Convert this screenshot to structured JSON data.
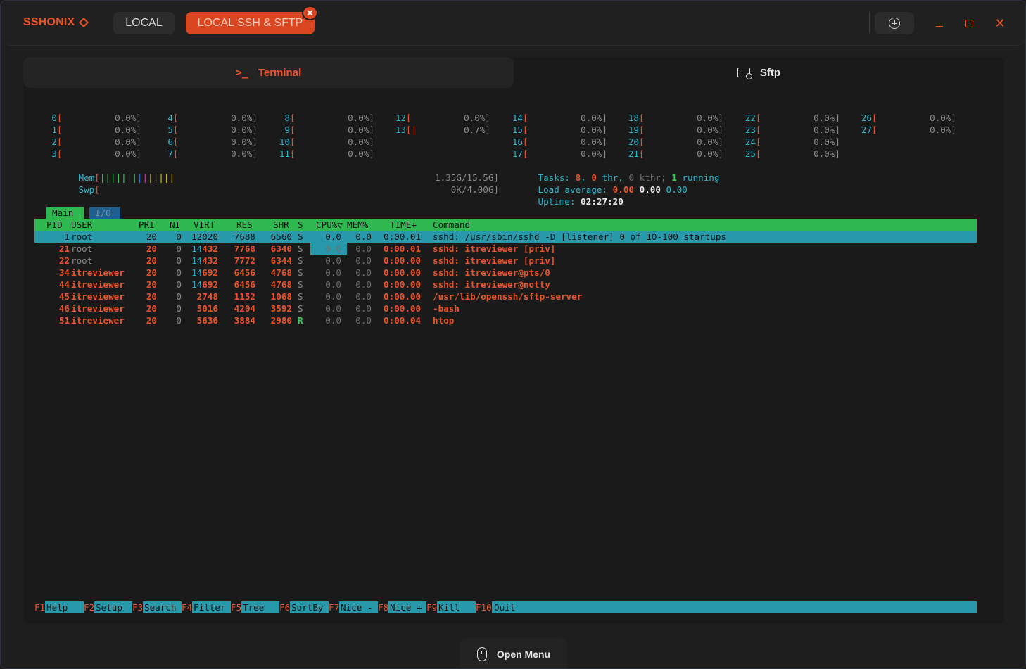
{
  "app": {
    "brand": "SSHONIX",
    "tabs": [
      {
        "label": "LOCAL",
        "active": false
      },
      {
        "label": "LOCAL SSH & SFTP",
        "active": true
      }
    ],
    "accent_color": "#e8542a"
  },
  "subtabs": {
    "terminal": "Terminal",
    "sftp": "Sftp"
  },
  "htop": {
    "cpus": [
      {
        "id": "0",
        "pct": "0.0%]"
      },
      {
        "id": "1",
        "pct": "0.0%]"
      },
      {
        "id": "2",
        "pct": "0.0%]"
      },
      {
        "id": "3",
        "pct": "0.0%]"
      },
      {
        "id": "4",
        "pct": "0.0%]"
      },
      {
        "id": "5",
        "pct": "0.0%]"
      },
      {
        "id": "6",
        "pct": "0.0%]"
      },
      {
        "id": "7",
        "pct": "0.0%]"
      },
      {
        "id": "8",
        "pct": "0.0%]"
      },
      {
        "id": "9",
        "pct": "0.0%]"
      },
      {
        "id": "10",
        "pct": "0.0%]"
      },
      {
        "id": "11",
        "pct": "0.0%]"
      },
      {
        "id": "12",
        "pct": "0.0%]"
      },
      {
        "id": "13",
        "pct": "0.7%]"
      },
      {
        "id": "14",
        "pct": "0.0%]"
      },
      {
        "id": "15",
        "pct": "0.0%]"
      },
      {
        "id": "16",
        "pct": "0.0%]"
      },
      {
        "id": "17",
        "pct": "0.0%]"
      },
      {
        "id": "18",
        "pct": "0.0%]"
      },
      {
        "id": "19",
        "pct": "0.0%]"
      },
      {
        "id": "20",
        "pct": "0.0%]"
      },
      {
        "id": "21",
        "pct": "0.0%]"
      },
      {
        "id": "22",
        "pct": "0.0%]"
      },
      {
        "id": "23",
        "pct": "0.0%]"
      },
      {
        "id": "24",
        "pct": "0.0%]"
      },
      {
        "id": "25",
        "pct": "0.0%]"
      },
      {
        "id": "26",
        "pct": "0.0%]"
      },
      {
        "id": "27",
        "pct": "0.0%]"
      }
    ],
    "mem_label": "Mem",
    "mem_value": "1.35G/15.5G]",
    "swp_label": "Swp",
    "swp_value": "0K/4.00G]",
    "tasks_label": "Tasks:",
    "tasks": "8",
    "thr": "0",
    "thr_label": "thr,",
    "kthr": "0",
    "kthr_label": "kthr;",
    "running": "1",
    "running_label": "running",
    "load_label": "Load average:",
    "load1": "0.00",
    "load5": "0.00",
    "load15": "0.00",
    "uptime_label": "Uptime:",
    "uptime": "02:27:20",
    "tab_main": "Main",
    "tab_io": "I/O",
    "columns": [
      "PID",
      "USER",
      "PRI",
      "NI",
      "VIRT",
      "RES",
      "SHR",
      "S",
      "CPU%▽",
      "MEM%",
      "TIME+",
      "Command"
    ],
    "processes": [
      {
        "pid": "1",
        "user": "root",
        "pri": "20",
        "ni": "0",
        "virt": "12020",
        "res": "7688",
        "shr": "6560",
        "s": "S",
        "cpu": "0.0",
        "mem": "0.0",
        "time": "0:00.01",
        "cmd": "sshd: /usr/sbin/sshd -D [listener] 0 of 10-100 startups"
      },
      {
        "pid": "21",
        "user": "root",
        "pri": "20",
        "ni": "0",
        "virt": "14432",
        "res": "7768",
        "shr": "6340",
        "s": "S",
        "cpu": "0.0",
        "mem": "0.0",
        "time": "0:00.01",
        "cmd": "sshd: itreviewer [priv]"
      },
      {
        "pid": "22",
        "user": "root",
        "pri": "20",
        "ni": "0",
        "virt": "14432",
        "res": "7772",
        "shr": "6344",
        "s": "S",
        "cpu": "0.0",
        "mem": "0.0",
        "time": "0:00.00",
        "cmd": "sshd: itreviewer [priv]"
      },
      {
        "pid": "34",
        "user": "itreviewer",
        "pri": "20",
        "ni": "0",
        "virt": "14692",
        "res": "6456",
        "shr": "4768",
        "s": "S",
        "cpu": "0.0",
        "mem": "0.0",
        "time": "0:00.00",
        "cmd": "sshd: itreviewer@pts/0"
      },
      {
        "pid": "44",
        "user": "itreviewer",
        "pri": "20",
        "ni": "0",
        "virt": "14692",
        "res": "6456",
        "shr": "4768",
        "s": "S",
        "cpu": "0.0",
        "mem": "0.0",
        "time": "0:00.00",
        "cmd": "sshd: itreviewer@notty"
      },
      {
        "pid": "45",
        "user": "itreviewer",
        "pri": "20",
        "ni": "0",
        "virt": "2748",
        "res": "1152",
        "shr": "1068",
        "s": "S",
        "cpu": "0.0",
        "mem": "0.0",
        "time": "0:00.00",
        "cmd": "/usr/lib/openssh/sftp-server"
      },
      {
        "pid": "46",
        "user": "itreviewer",
        "pri": "20",
        "ni": "0",
        "virt": "5016",
        "res": "4204",
        "shr": "3592",
        "s": "S",
        "cpu": "0.0",
        "mem": "0.0",
        "time": "0:00.00",
        "cmd": "-bash"
      },
      {
        "pid": "51",
        "user": "itreviewer",
        "pri": "20",
        "ni": "0",
        "virt": "5636",
        "res": "3884",
        "shr": "2980",
        "s": "R",
        "cpu": "0.0",
        "mem": "0.0",
        "time": "0:00.04",
        "cmd": "htop"
      }
    ],
    "fkeys": [
      {
        "key": "F1",
        "label": "Help"
      },
      {
        "key": "F2",
        "label": "Setup"
      },
      {
        "key": "F3",
        "label": "Search"
      },
      {
        "key": "F4",
        "label": "Filter"
      },
      {
        "key": "F5",
        "label": "Tree"
      },
      {
        "key": "F6",
        "label": "SortBy"
      },
      {
        "key": "F7",
        "label": "Nice -"
      },
      {
        "key": "F8",
        "label": "Nice +"
      },
      {
        "key": "F9",
        "label": "Kill"
      },
      {
        "key": "F10",
        "label": "Quit"
      }
    ]
  },
  "footer": {
    "open_menu": "Open Menu"
  }
}
